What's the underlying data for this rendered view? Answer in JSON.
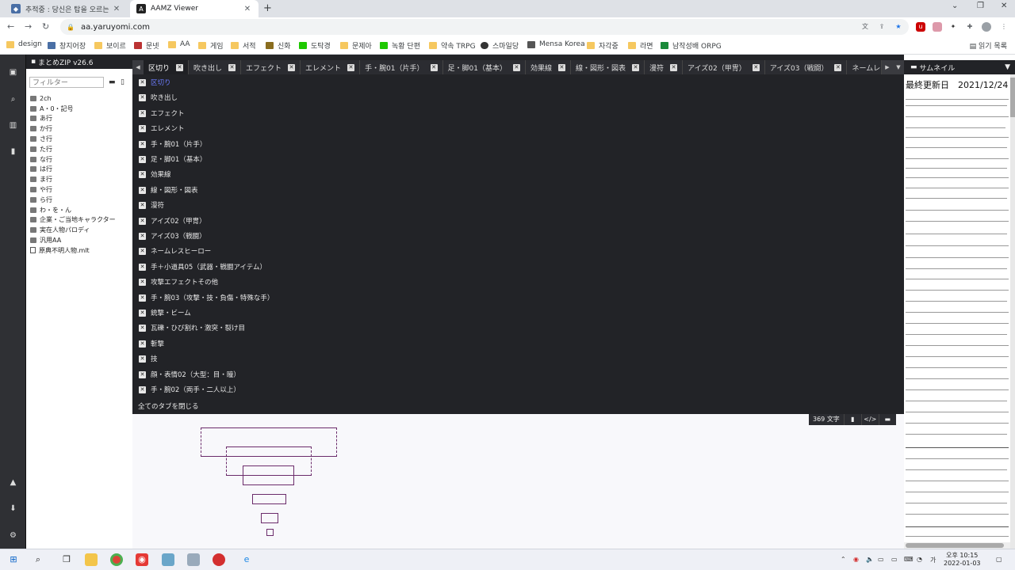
{
  "browser": {
    "tabs": [
      {
        "title": "추적중 : 당신은 탑을 오르는 것",
        "active": false
      },
      {
        "title": "AAMZ Viewer",
        "active": true
      }
    ],
    "new_tab": "+",
    "url": "aa.yaruyomi.com",
    "bookmarks": [
      "design",
      "창지어장",
      "보이르",
      "문넷",
      "AA",
      "게임",
      "서적",
      "신화",
      "도탁경",
      "문제아",
      "녹황 단편",
      "약속 TRPG",
      "스마일당",
      "Mensa Korea",
      "자각중",
      "라면",
      "남작성배 ORPG"
    ],
    "reading_list": "읽기 목록"
  },
  "sidebar": {
    "title": "まとめZIP v26.6",
    "filter_placeholder": "フィルター",
    "items": [
      {
        "label": "2ch",
        "type": "folder"
      },
      {
        "label": "A・0・記号",
        "type": "folder"
      },
      {
        "label": "あ行",
        "type": "folder"
      },
      {
        "label": "か行",
        "type": "folder"
      },
      {
        "label": "さ行",
        "type": "folder"
      },
      {
        "label": "た行",
        "type": "folder"
      },
      {
        "label": "な行",
        "type": "folder"
      },
      {
        "label": "は行",
        "type": "folder"
      },
      {
        "label": "ま行",
        "type": "folder"
      },
      {
        "label": "や行",
        "type": "folder"
      },
      {
        "label": "ら行",
        "type": "folder"
      },
      {
        "label": "わ・を・ん",
        "type": "folder"
      },
      {
        "label": "企業・ご当地キャラクター",
        "type": "folder"
      },
      {
        "label": "実在人物パロディ",
        "type": "folder"
      },
      {
        "label": "汎用AA",
        "type": "folder"
      },
      {
        "label": "原典不明人物.mlt",
        "type": "file"
      }
    ]
  },
  "tabbar": {
    "tabs": [
      "区切り",
      "吹き出し",
      "エフェクト",
      "エレメント",
      "手・腕01（片手）",
      "足・脚01（基本）",
      "効果線",
      "線・図形・図表",
      "漫符",
      "アイズ02（甲冑）",
      "アイズ03（戦闘）",
      "ネームレスヒーロー"
    ]
  },
  "dropdown": {
    "items": [
      "区切り",
      "吹き出し",
      "エフェクト",
      "エレメント",
      "手・腕01（片手）",
      "足・脚01（基本）",
      "効果線",
      "線・図形・図表",
      "漫符",
      "アイズ02（甲冑）",
      "アイズ03（戦闘）",
      "ネームレスヒーロー",
      "手＋小道具05（武器・戦闘アイテム）",
      "攻撃エフェクトその他",
      "手・腕03（攻撃・技・負傷・特殊な手）",
      "銃撃・ビーム",
      "瓦礫・ひび割れ・激突・裂け目",
      "斬撃",
      "技",
      "顔・表情02（大型：目・瞳）",
      "手・腕02（両手・二人以上）"
    ],
    "close_all": "全てのタブを閉じる"
  },
  "canvas": {
    "char_count": "369 文字"
  },
  "thumbnails": {
    "title": "サムネイル",
    "last_updated": "最終更新日　2021/12/24"
  },
  "taskbar": {
    "time": "오후 10:15",
    "date": "2022-01-03"
  }
}
